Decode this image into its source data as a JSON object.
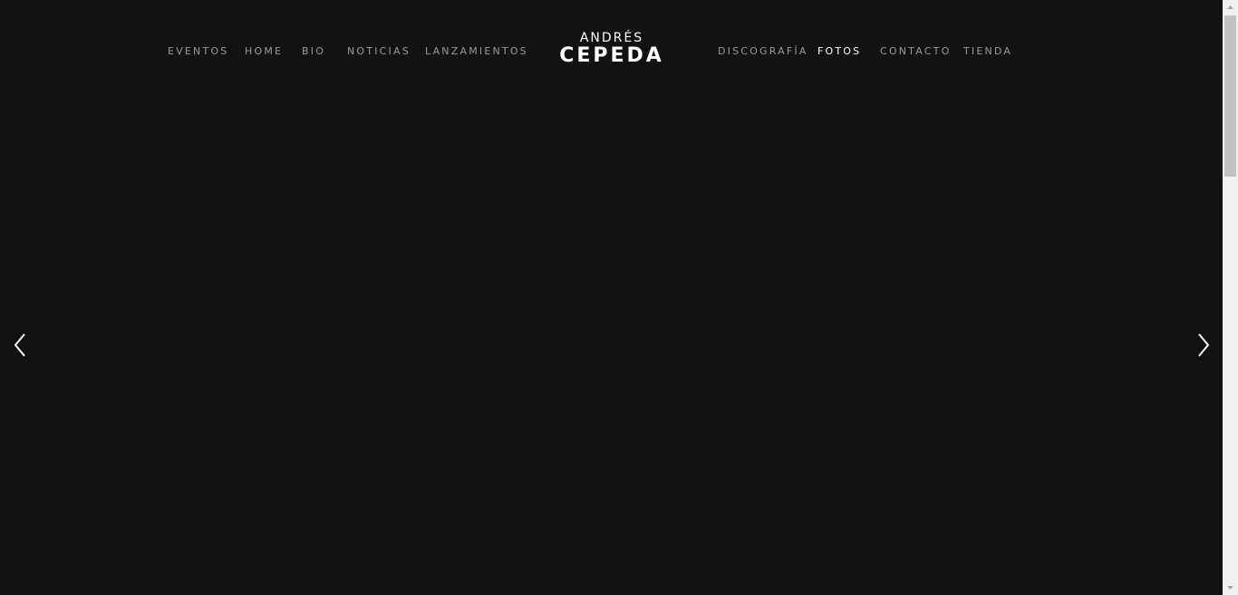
{
  "nav": {
    "left_items": [
      {
        "label": "EVENTOS"
      },
      {
        "label": "HOME"
      },
      {
        "label": "BIO"
      },
      {
        "label": "NOTICIAS"
      },
      {
        "label": "LANZAMIENTOS"
      }
    ],
    "right_items": [
      {
        "label": "DISCOGRAFÍA"
      },
      {
        "label": "FOTOS",
        "active": true
      },
      {
        "label": "CONTACTO"
      },
      {
        "label": "TIENDA"
      }
    ]
  },
  "logo": {
    "top": "ANDRÉS",
    "bottom": "CEPEDA"
  },
  "slider": {
    "prev_icon": "chevron-left-icon",
    "next_icon": "chevron-right-icon"
  },
  "colors": {
    "background": "#121212",
    "nav_text": "#9a9a9a",
    "active_text": "#ffffff"
  }
}
